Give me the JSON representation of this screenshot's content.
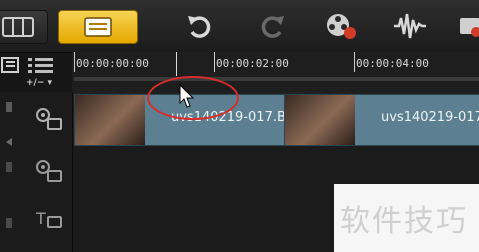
{
  "toolbar": {
    "buttons": [
      {
        "name": "storyboard-view",
        "icon": "film-strip-icon"
      },
      {
        "name": "timeline-view",
        "icon": "timeline-icon",
        "active": true
      },
      {
        "name": "undo",
        "icon": "undo-icon"
      },
      {
        "name": "redo",
        "icon": "redo-icon"
      },
      {
        "name": "record-capture",
        "icon": "film-reel-record-icon"
      },
      {
        "name": "audio-mixer",
        "icon": "waveform-icon"
      },
      {
        "name": "auto-music",
        "icon": "music-icon"
      }
    ],
    "accent_color": "#f2c230"
  },
  "timeline": {
    "add_remove_tracks": "+/− ▾",
    "time_labels": [
      "00:00:00:00",
      "00:00:02:00",
      "00:00:04:00"
    ],
    "tracks": [
      {
        "name": "video-track",
        "icon": "video-track-icon"
      },
      {
        "name": "overlay-track",
        "icon": "overlay-track-icon"
      },
      {
        "name": "title-track",
        "icon": "title-track-icon"
      },
      {
        "name": "voice-track",
        "icon": "voice-track-icon"
      }
    ],
    "clips": [
      {
        "label": "uvs140219-017.B"
      },
      {
        "label": "uvs140219-017"
      }
    ],
    "clip_color": "#5c8091"
  },
  "annotation": {
    "circle_color": "#d62c2c"
  },
  "watermark": {
    "text": "软件技巧"
  }
}
